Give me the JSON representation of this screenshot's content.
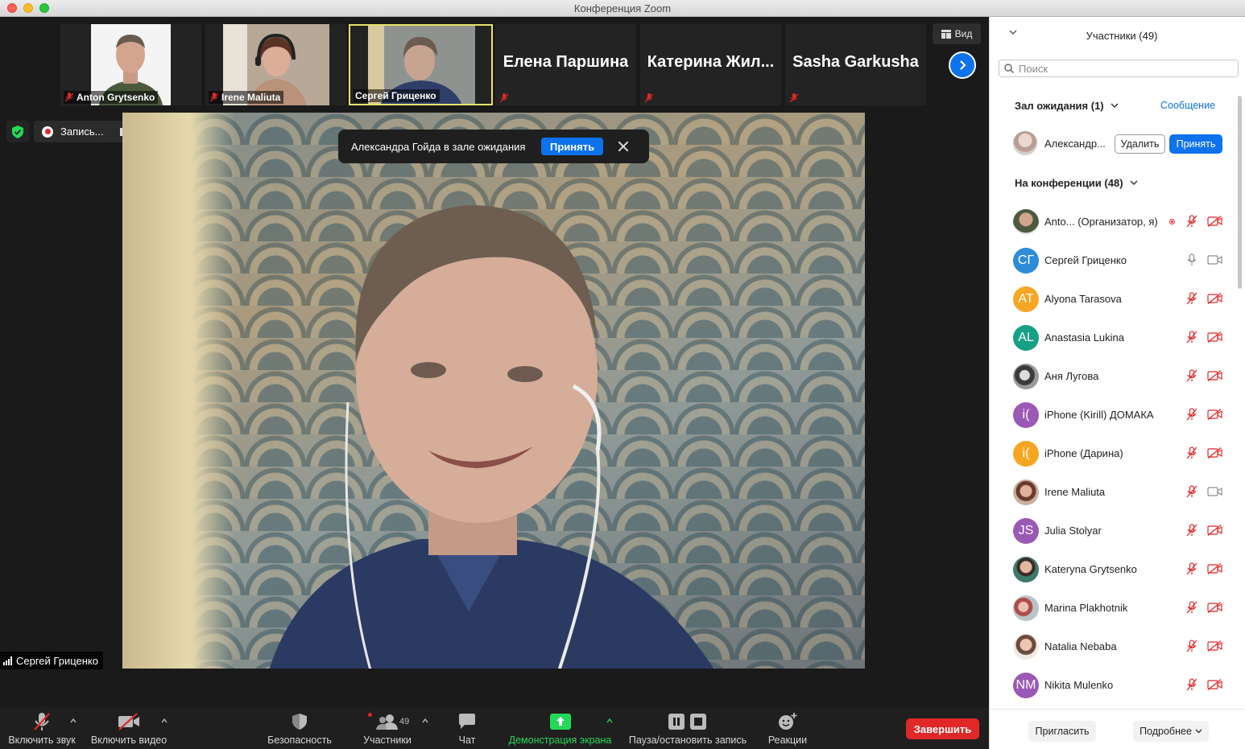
{
  "window": {
    "title": "Конференция Zoom"
  },
  "thumbnails": [
    {
      "name": "Anton Grytsenko",
      "type": "video"
    },
    {
      "name": "Irene Maliuta",
      "type": "video"
    },
    {
      "name": "Сергей Гриценко",
      "type": "video",
      "active": true
    },
    {
      "name": "Елена Паршина",
      "type": "name"
    },
    {
      "name": "Катерина Жил...",
      "type": "name"
    },
    {
      "name": "Sasha Garkusha",
      "type": "name"
    }
  ],
  "view_button": {
    "label": "Вид"
  },
  "recording": {
    "label": "Запись..."
  },
  "waiting_notice": {
    "text": "Александра Гойда в зале ожидания",
    "accept_label": "Принять"
  },
  "speaker": {
    "name": "Сергей Гриценко"
  },
  "toolbar": {
    "unmute": "Включить звук",
    "start_video": "Включить видео",
    "security": "Безопасность",
    "participants": "Участники",
    "participants_count": "49",
    "chat": "Чат",
    "share_screen": "Демонстрация экрана",
    "pause_record": "Пауза/остановить запись",
    "reactions": "Реакции",
    "end": "Завершить"
  },
  "panel": {
    "title": "Участники (49)",
    "search_placeholder": "Поиск",
    "waiting_room": {
      "header": "Зал ожидания (1)",
      "message_link": "Сообщение",
      "person": "Александр...",
      "remove_label": "Удалить",
      "admit_label": "Принять"
    },
    "in_meeting_header": "На конференции (48)",
    "participants": [
      {
        "name": "Anto... (Организатор, я)",
        "initials": "",
        "color": "",
        "photo": "anton",
        "mic": "off",
        "cam": "off",
        "recording": true
      },
      {
        "name": "Сергей Гриценко",
        "initials": "СГ",
        "color": "#2d8cd8",
        "mic": "on",
        "cam": "on"
      },
      {
        "name": "Alyona Tarasova",
        "initials": "AT",
        "color": "#f5a623",
        "mic": "off",
        "cam": "off"
      },
      {
        "name": "Anastasia Lukina",
        "initials": "AL",
        "color": "#16a085",
        "mic": "off",
        "cam": "off"
      },
      {
        "name": "Аня Лугова",
        "initials": "",
        "color": "",
        "photo": "bw",
        "mic": "off",
        "cam": "off"
      },
      {
        "name": "iPhone (Kirill) ДОМАКА",
        "initials": "i(",
        "color": "#9b59b6",
        "mic": "off",
        "cam": "off"
      },
      {
        "name": "iPhone (Дарина)",
        "initials": "i(",
        "color": "#f5a623",
        "mic": "off",
        "cam": "off"
      },
      {
        "name": "Irene Maliuta",
        "initials": "",
        "color": "",
        "photo": "irene",
        "mic": "off",
        "cam": "on"
      },
      {
        "name": "Julia Stolyar",
        "initials": "JS",
        "color": "#9b59b6",
        "mic": "off",
        "cam": "off"
      },
      {
        "name": "Kateryna Grytsenko",
        "initials": "",
        "color": "",
        "photo": "kateryna",
        "mic": "off",
        "cam": "off"
      },
      {
        "name": "Marina Plakhotnik",
        "initials": "",
        "color": "",
        "photo": "marina",
        "mic": "off",
        "cam": "off"
      },
      {
        "name": "Natalia Nebaba",
        "initials": "",
        "color": "",
        "photo": "natalia",
        "mic": "off",
        "cam": "off"
      },
      {
        "name": "Nikita Mulenko",
        "initials": "NM",
        "color": "#9b59b6",
        "mic": "off",
        "cam": "off"
      }
    ],
    "invite_label": "Пригласить",
    "more_label": "Подробнее"
  }
}
